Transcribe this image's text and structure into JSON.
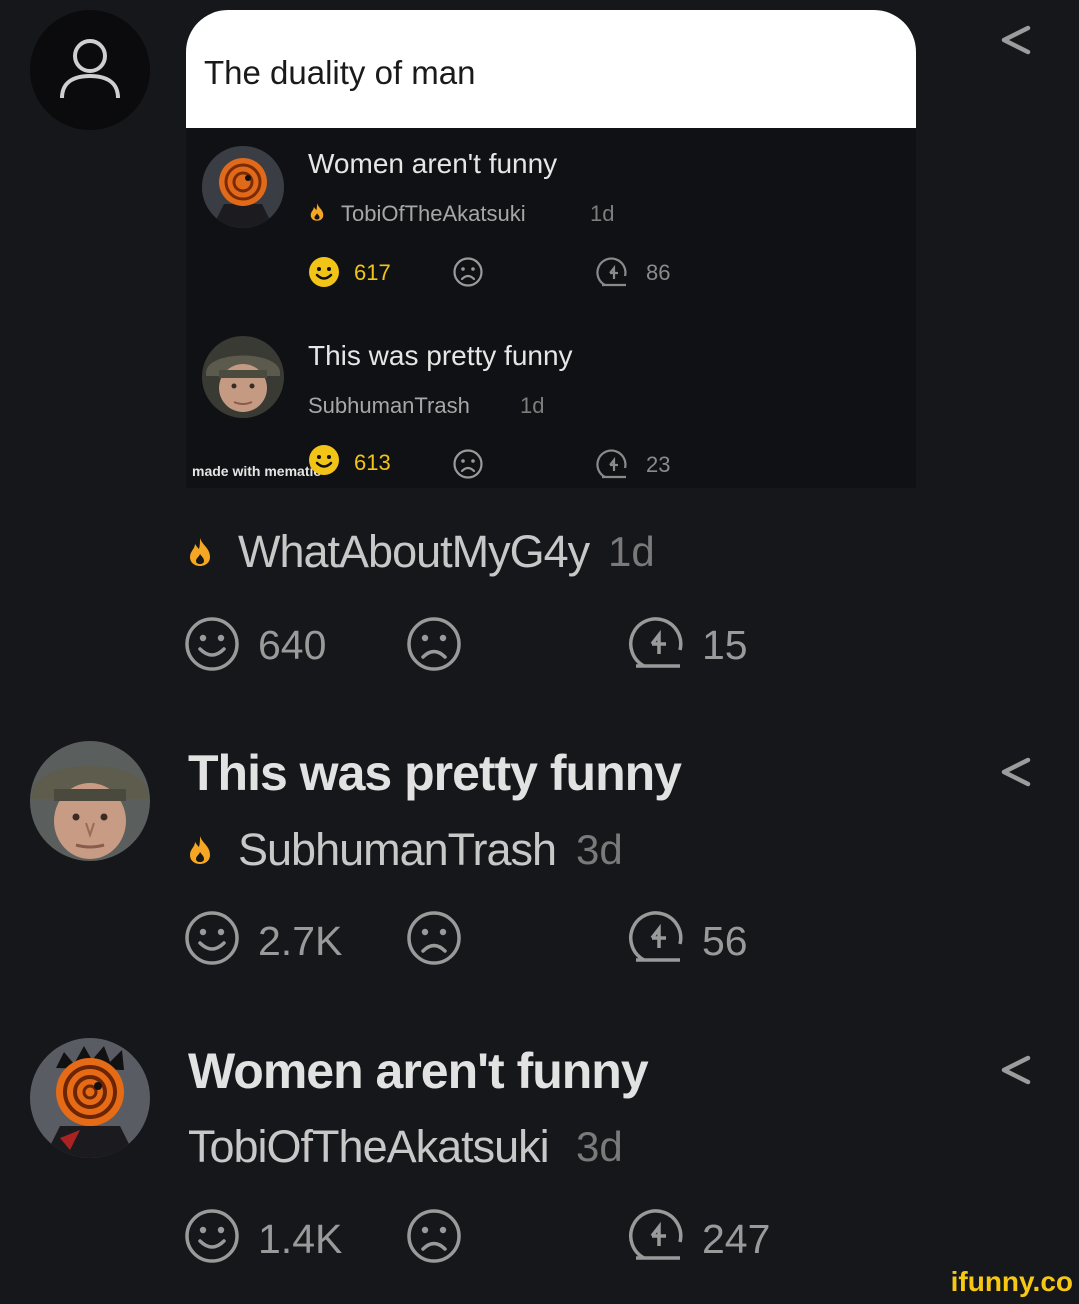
{
  "meme": {
    "caption": "The duality of man",
    "posts": [
      {
        "title": "Women aren't funny",
        "author": "TobiOfTheAkatsuki",
        "time": "1d",
        "smiles": "617",
        "replies": "86"
      },
      {
        "title": "This was pretty funny",
        "author": "SubhumanTrash",
        "time": "1d",
        "smiles": "613",
        "replies": "23"
      }
    ],
    "watermark": "made with mematic"
  },
  "comments": [
    {
      "author": "WhatAboutMyG4y",
      "time": "1d",
      "smiles": "640",
      "replies": "15"
    },
    {
      "title": "This was pretty funny",
      "author": "SubhumanTrash",
      "time": "3d",
      "smiles": "2.7K",
      "replies": "56"
    },
    {
      "title": "Women aren't funny",
      "author": "TobiOfTheAkatsuki",
      "time": "3d",
      "smiles": "1.4K",
      "replies": "247"
    }
  ],
  "brand": "ifunny.co",
  "colors": {
    "background": "#16171b",
    "flame": "#f5a623",
    "smile_yellow": "#f2c417"
  }
}
